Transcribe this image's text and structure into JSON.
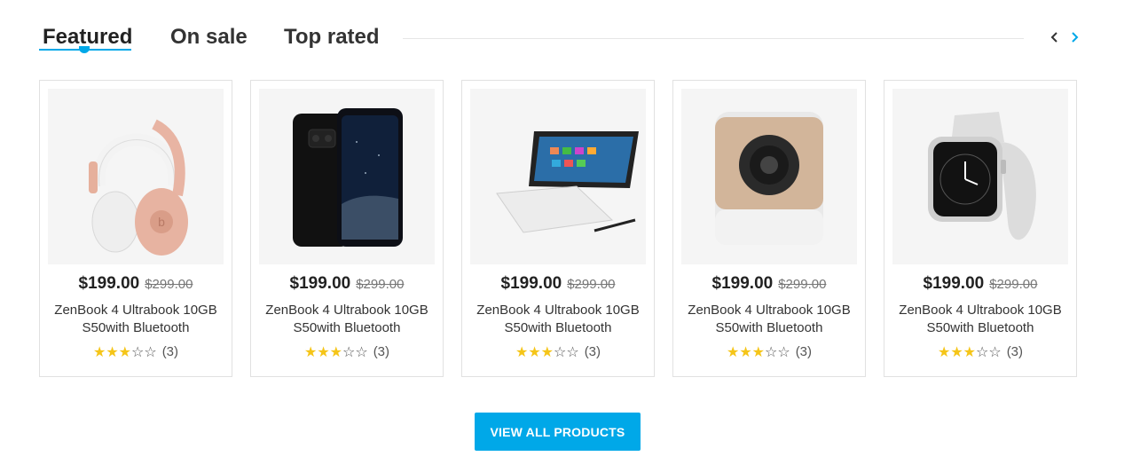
{
  "tabs": [
    {
      "label": "Featured",
      "active": true
    },
    {
      "label": "On sale",
      "active": false
    },
    {
      "label": "Top rated",
      "active": false
    }
  ],
  "nav": {
    "prev_icon": "chevron-left-icon",
    "next_icon": "chevron-right-icon"
  },
  "colors": {
    "accent": "#00a8e8",
    "star": "#f5c518",
    "text": "#222222",
    "muted": "#777777"
  },
  "products": [
    {
      "image": "headphones-image",
      "price": "$199.00",
      "old_price": "$299.00",
      "name": "ZenBook 4 Ultrabook 10GB S50with Bluetooth",
      "rating": 3,
      "rating_max": 5,
      "review_count": "(3)"
    },
    {
      "image": "smartphone-image",
      "price": "$199.00",
      "old_price": "$299.00",
      "name": "ZenBook 4 Ultrabook 10GB S50with Bluetooth",
      "rating": 3,
      "rating_max": 5,
      "review_count": "(3)"
    },
    {
      "image": "tablet-keyboard-image",
      "price": "$199.00",
      "old_price": "$299.00",
      "name": "ZenBook 4 Ultrabook 10GB S50with Bluetooth",
      "rating": 3,
      "rating_max": 5,
      "review_count": "(3)"
    },
    {
      "image": "home-camera-image",
      "price": "$199.00",
      "old_price": "$299.00",
      "name": "ZenBook 4 Ultrabook 10GB S50with Bluetooth",
      "rating": 3,
      "rating_max": 5,
      "review_count": "(3)"
    },
    {
      "image": "smartwatch-image",
      "price": "$199.00",
      "old_price": "$299.00",
      "name": "ZenBook 4 Ultrabook 10GB S50with Bluetooth",
      "rating": 3,
      "rating_max": 5,
      "review_count": "(3)"
    }
  ],
  "view_all_label": "VIEW ALL PRODUCTS"
}
